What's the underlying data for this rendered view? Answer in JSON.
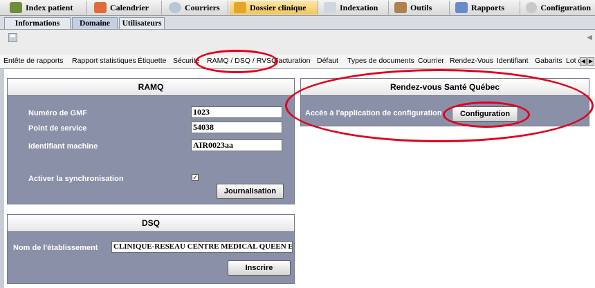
{
  "colors": {
    "panel_bg": "#8a90a8",
    "highlight_ring": "#e0001b",
    "active_tab": "#f2c65e"
  },
  "modules": [
    {
      "label": "Index patient",
      "icon": "patients-icon"
    },
    {
      "label": "Calendrier",
      "icon": "calendar-icon"
    },
    {
      "label": "Courriers",
      "icon": "mail-icon"
    },
    {
      "label": "Dossier clinique",
      "icon": "folder-icon"
    },
    {
      "label": "Indexation",
      "icon": "scanner-icon"
    },
    {
      "label": "Outils",
      "icon": "tools-icon"
    },
    {
      "label": "Rapports",
      "icon": "chart-icon"
    },
    {
      "label": "Configuration",
      "icon": "gear-icon"
    }
  ],
  "subtabs": [
    "Informations",
    "Domaine",
    "Utilisateurs"
  ],
  "settings_tabs": [
    "Entête de rapports",
    "Rapport statistiques",
    "Étiquette",
    "Sécurité",
    "RAMQ / DSQ / RVSQ",
    "Facturation",
    "Défaut",
    "Types de documents",
    "Courrier",
    "Rendez-Vous",
    "Identifiant",
    "Gabarits",
    "Lot d"
  ],
  "ramq": {
    "title": "RAMQ",
    "gmf_label": "Numéro de GMF",
    "gmf_value": "1023",
    "service_label": "Point de service",
    "service_value": "54038",
    "machine_label": "Identifiant machine",
    "machine_value": "AIR0023aa",
    "sync_label": "Activer la synchronisation",
    "sync_checked": true,
    "journal_button": "Journalisation"
  },
  "dsq": {
    "title": "DSQ",
    "etab_label": "Nom de l'établissement",
    "etab_value": "CLINIQUE-RESEAU CENTRE MEDICAL QUEEN ELIS",
    "inscrire_button": "Inscrire"
  },
  "rvsq": {
    "title": "Rendez-vous Santé Québec",
    "access_label": "Accès à l'application de configuration",
    "config_button": "Configuration"
  }
}
